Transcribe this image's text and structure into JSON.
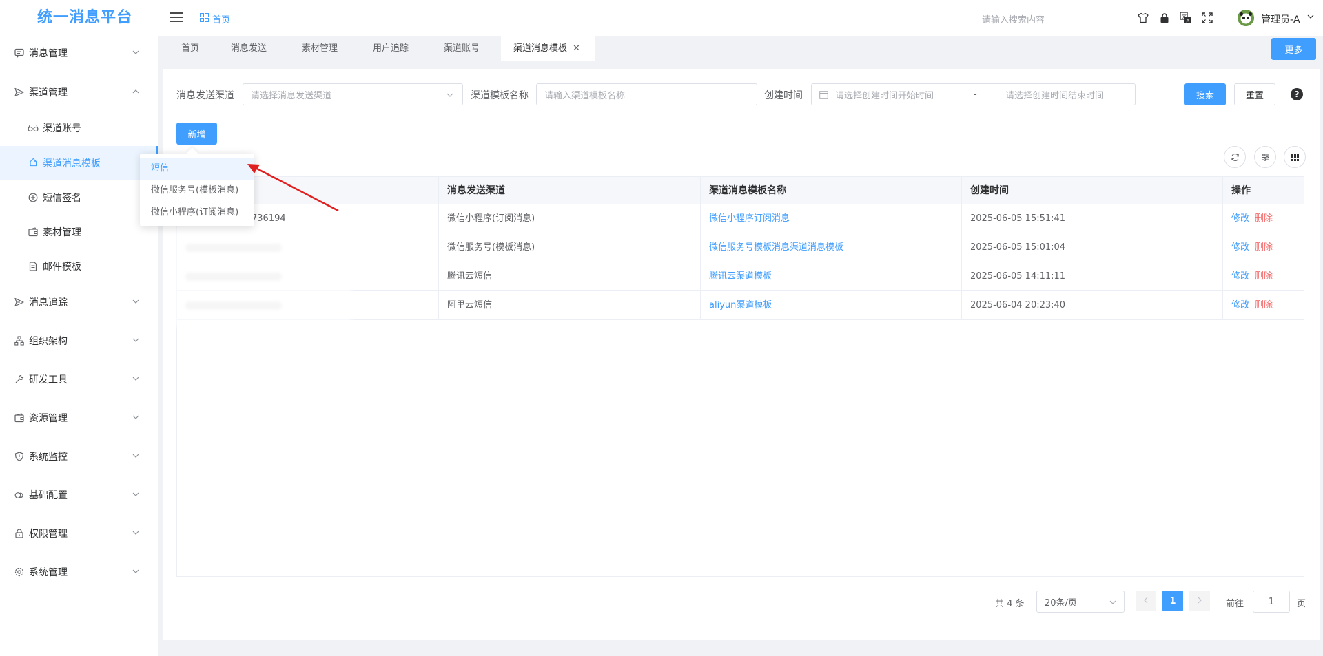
{
  "app": {
    "title": "统一消息平台"
  },
  "header": {
    "breadcrumb": "首页",
    "search_placeholder": "请输入搜索内容",
    "username": "管理员-A",
    "icons": [
      "shirt-icon",
      "lock-icon",
      "translate-icon",
      "fullscreen-icon"
    ]
  },
  "sidebar": {
    "items": [
      {
        "label": "消息管理",
        "icon": "chat-icon",
        "expanded": false
      },
      {
        "label": "渠道管理",
        "icon": "send-icon",
        "expanded": true
      },
      {
        "label": "渠道账号",
        "icon": "glasses-icon",
        "sub": true
      },
      {
        "label": "渠道消息模板",
        "icon": "tag-icon",
        "sub": true,
        "active": true
      },
      {
        "label": "短信签名",
        "icon": "plus-circle-icon",
        "sub": true
      },
      {
        "label": "素材管理",
        "icon": "wallet-icon",
        "sub": true
      },
      {
        "label": "邮件模板",
        "icon": "document-icon",
        "sub": true
      },
      {
        "label": "消息追踪",
        "icon": "send-icon",
        "expanded": false
      },
      {
        "label": "组织架构",
        "icon": "org-icon",
        "expanded": false
      },
      {
        "label": "研发工具",
        "icon": "wrench-icon",
        "expanded": false
      },
      {
        "label": "资源管理",
        "icon": "wallet-icon",
        "expanded": false
      },
      {
        "label": "系统监控",
        "icon": "shield-icon",
        "expanded": false
      },
      {
        "label": "基础配置",
        "icon": "cloud-icon",
        "expanded": false
      },
      {
        "label": "权限管理",
        "icon": "lock-icon",
        "expanded": false
      },
      {
        "label": "系统管理",
        "icon": "gear-icon",
        "expanded": false
      }
    ]
  },
  "tabs": [
    {
      "label": "首页"
    },
    {
      "label": "消息发送"
    },
    {
      "label": "素材管理"
    },
    {
      "label": "用户追踪"
    },
    {
      "label": "渠道账号"
    },
    {
      "label": "渠道消息模板",
      "active": true
    }
  ],
  "more_label": "更多",
  "filters": {
    "channel_label": "消息发送渠道",
    "channel_placeholder": "请选择消息发送渠道",
    "template_label": "渠道模板名称",
    "template_placeholder": "请输入渠道模板名称",
    "time_label": "创建时间",
    "time_start_placeholder": "请选择创建时间开始时间",
    "time_separator": "-",
    "time_end_placeholder": "请选择创建时间结束时间",
    "search_label": "搜索",
    "reset_label": "重置",
    "help_label": "?"
  },
  "add_label": "新增",
  "dropdown": {
    "items": [
      "短信",
      "微信服务号(模板消息)",
      "微信小程序(订阅消息)"
    ],
    "hovered": "短信"
  },
  "table": {
    "columns": [
      "",
      "消息发送渠道",
      "渠道消息模板名称",
      "创建时间",
      "操作"
    ],
    "rows": [
      {
        "id_suffix": "736194",
        "channel": "微信小程序(订阅消息)",
        "name": "微信小程序订阅消息",
        "created": "2025-06-05 15:51:41"
      },
      {
        "id_suffix": "",
        "channel": "微信服务号(模板消息)",
        "name": "微信服务号模板消息渠道消息模板",
        "created": "2025-06-05 15:01:04"
      },
      {
        "id_suffix": "",
        "channel": "腾讯云短信",
        "name": "腾讯云渠道模板",
        "created": "2025-06-05 14:11:11"
      },
      {
        "id_suffix": "",
        "channel": "阿里云短信",
        "name": "aliyun渠道模板",
        "created": "2025-06-04 20:23:40"
      }
    ],
    "edit_label": "修改",
    "delete_label": "删除"
  },
  "pagination": {
    "total_text": "共 4 条",
    "page_size": "20条/页",
    "current_page": "1",
    "goto_label": "前往",
    "goto_value": "1",
    "page_unit": "页"
  },
  "colors": {
    "primary": "#409eff",
    "danger": "#f56c6c",
    "annotation_arrow": "#e02020"
  }
}
